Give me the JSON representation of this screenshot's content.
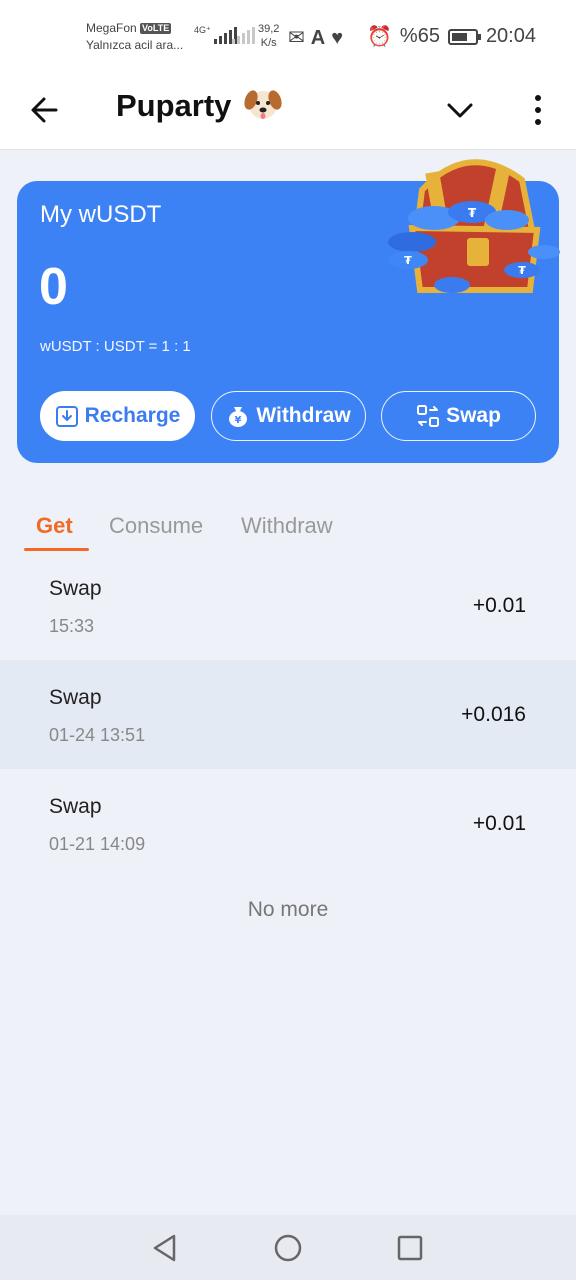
{
  "status_bar": {
    "carrier": "MegaFon",
    "volte": "VoLTE",
    "carrier_sub": "Yalnızca acil ara...",
    "network": "4G⁺",
    "speed_value": "39,2",
    "speed_unit": "K/s",
    "battery": "%65",
    "time": "20:04"
  },
  "app_bar": {
    "title": "Puparty",
    "title_icon": "dog-face-icon"
  },
  "wallet": {
    "title": "My wUSDT",
    "balance": "0",
    "rate": "wUSDT : USDT = 1 : 1",
    "buttons": {
      "recharge": "Recharge",
      "withdraw": "Withdraw",
      "swap": "Swap"
    },
    "accent_color": "#3d82f5"
  },
  "tabs": {
    "items": [
      "Get",
      "Consume",
      "Withdraw"
    ],
    "active": "Get",
    "active_color": "#f06a26"
  },
  "transactions": [
    {
      "title": "Swap",
      "time": "15:33",
      "amount": "+0.01"
    },
    {
      "title": "Swap",
      "time": "01-24 13:51",
      "amount": "+0.016"
    },
    {
      "title": "Swap",
      "time": "01-21 14:09",
      "amount": "+0.01"
    }
  ],
  "list_footer": "No more"
}
